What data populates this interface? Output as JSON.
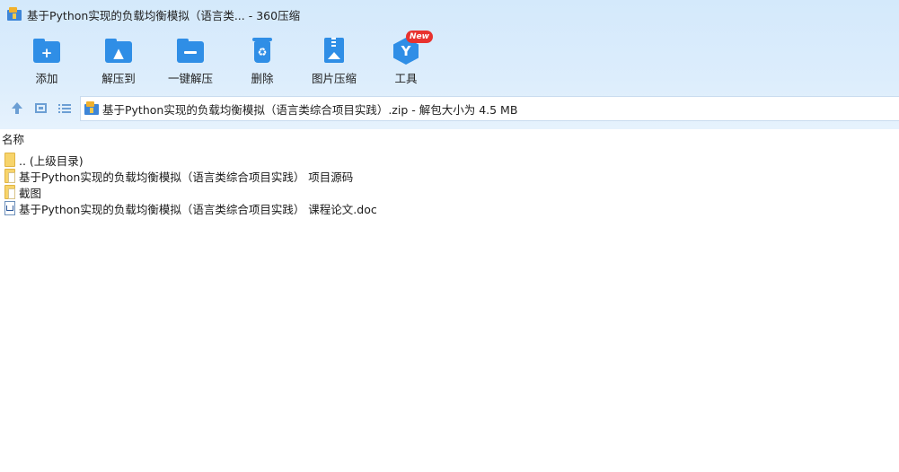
{
  "window": {
    "title": "基于Python实现的负载均衡模拟（语言类... - 360压缩"
  },
  "toolbar": {
    "items": [
      {
        "label": "添加",
        "icon": "folder-add-icon"
      },
      {
        "label": "解压到",
        "icon": "folder-extract-icon"
      },
      {
        "label": "一键解压",
        "icon": "folder-oneclick-icon"
      },
      {
        "label": "删除",
        "icon": "recycle-bin-icon"
      },
      {
        "label": "图片压缩",
        "icon": "image-compress-icon"
      },
      {
        "label": "工具",
        "icon": "tools-icon",
        "badge": "New"
      }
    ]
  },
  "navbar": {
    "address": "基于Python实现的负载均衡模拟（语言类综合项目实践）.zip - 解包大小为 4.5 MB"
  },
  "filelist": {
    "column_name": "名称",
    "rows": [
      {
        "name": ".. (上级目录)",
        "icon": "folder-icon"
      },
      {
        "name": "基于Python实现的负载均衡模拟（语言类综合项目实践） 项目源码",
        "icon": "folder-file-icon"
      },
      {
        "name": "截图",
        "icon": "folder-file-icon"
      },
      {
        "name": "基于Python实现的负载均衡模拟（语言类综合项目实践） 课程论文.doc",
        "icon": "word-doc-icon"
      }
    ]
  },
  "colors": {
    "accent": "#2f8ee6",
    "header_bg": "#d4e9fb",
    "badge": "#e8322f"
  }
}
